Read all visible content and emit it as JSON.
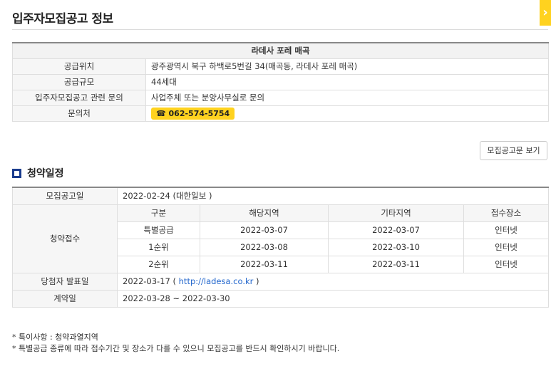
{
  "page": {
    "title": "입주자모집공고 정보"
  },
  "info": {
    "header": "라데사 포레 매곡",
    "rows": [
      {
        "label": "공급위치",
        "value": "광주광역시 북구 하백로5번길 34(매곡동, 라데사 포레 매곡)"
      },
      {
        "label": "공급규모",
        "value": "44세대"
      },
      {
        "label": "입주자모집공고 관련 문의",
        "value": "사업주체 또는 분양사무실로 문의"
      }
    ],
    "contact_label": "문의처",
    "phone": "☎ 062-574-5754"
  },
  "view_button_label": "모집공고문 보기",
  "schedule": {
    "section_title": "청약일정",
    "announce_label": "모집공고일",
    "announce_value": "2022-02-24 (대한일보 )",
    "apply_label": "청약접수",
    "apply_headers": [
      "구분",
      "해당지역",
      "기타지역",
      "접수장소"
    ],
    "apply_rows": [
      [
        "특별공급",
        "2022-03-07",
        "2022-03-07",
        "인터넷"
      ],
      [
        "1순위",
        "2022-03-08",
        "2022-03-10",
        "인터넷"
      ],
      [
        "2순위",
        "2022-03-11",
        "2022-03-11",
        "인터넷"
      ]
    ],
    "winner_label": "당첨자 발표일",
    "winner_date": "2022-03-17 (",
    "winner_link": "http://ladesa.co.kr",
    "winner_tail": ")",
    "contract_label": "계약일",
    "contract_value": "2022-03-28 ~ 2022-03-30"
  },
  "notes": [
    "* 특이사항 : 청약과열지역",
    "* 특별공급 종류에 따라 접수기간 및 장소가 다를 수 있으니 모집공고를 반드시 확인하시기 바랍니다."
  ],
  "colors": {
    "accent_yellow": "#ffd21f",
    "section_icon": "#1a3c8e",
    "link": "#2266cc"
  }
}
